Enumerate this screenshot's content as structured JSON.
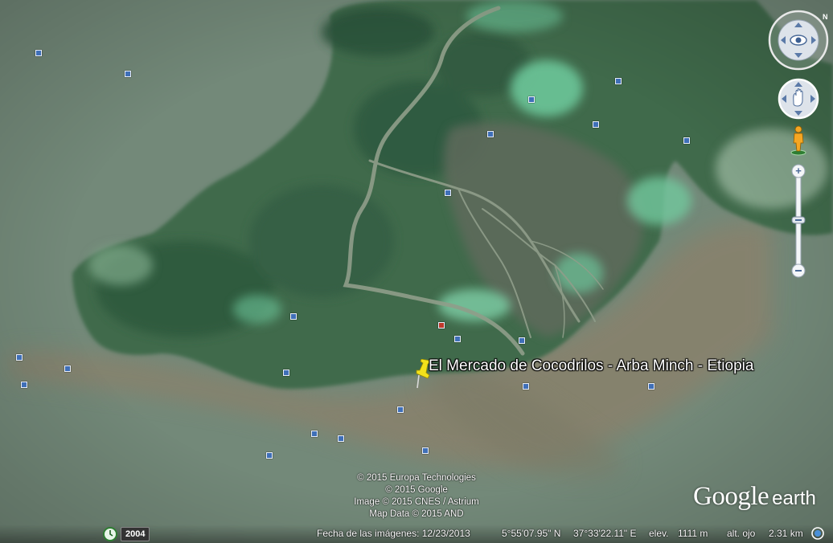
{
  "placemark": {
    "label": "El Mercado de Cocodrilos - Arba Minch - Etiopia",
    "icon": "yellow-pushpin-icon"
  },
  "attribution": [
    "© 2015 Europa Technologies",
    "© 2015 Google",
    "Image © 2015 CNES / Astrium",
    "Map Data © 2015 AND"
  ],
  "brand": {
    "google": "Google",
    "earth": "earth"
  },
  "status_bar": {
    "historical_year": "2004",
    "imagery_date": "Fecha de las imágenes: 12/23/2013",
    "latitude": "5°55'07.95\" N",
    "longitude": "37°33'22.11\" E",
    "elevation_label": "elev.",
    "elevation_value": "1111 m",
    "eye_alt_label": "alt. ojo",
    "eye_alt_value": "2.31 km"
  },
  "colors": {
    "water": "#6f8676",
    "forest": "#3e6a4c",
    "algae": "#6cc49a",
    "sediment": "#8a7e6a",
    "photo_marker": "#3f6fb8"
  },
  "controls": {
    "look": "look-joystick-icon",
    "move": "move-joystick-icon",
    "street_view": "pegman-icon",
    "zoom_in": "+",
    "zoom_out": "−"
  }
}
